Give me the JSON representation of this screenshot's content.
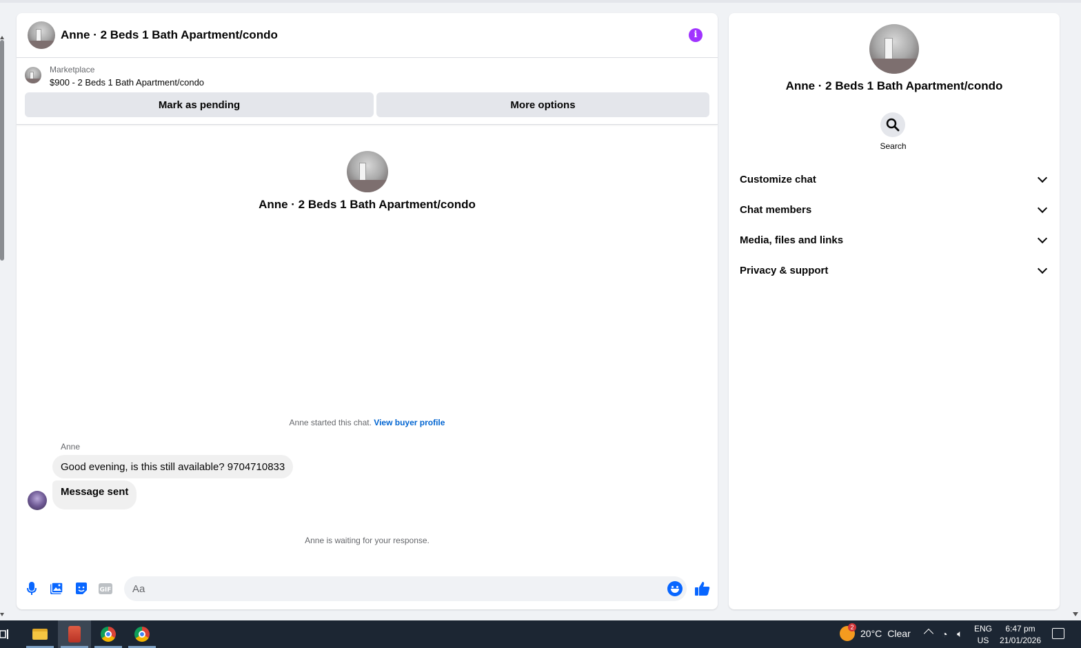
{
  "chat": {
    "title": "Anne · 2 Beds 1 Bath Apartment/condo",
    "info_icon": "info-icon",
    "marketplace": {
      "label": "Marketplace",
      "item": "$900 - 2 Beds 1 Bath Apartment/condo",
      "mark_pending_label": "Mark as pending",
      "more_options_label": "More options"
    },
    "intro_title": "Anne · 2 Beds 1 Bath Apartment/condo",
    "started_text": "Anne started this chat.",
    "view_profile_link": "View buyer profile",
    "messages": [
      {
        "sender": "Anne",
        "text": "Good evening, is this still available? 9704710833"
      },
      {
        "sender": "",
        "text": "Message sent"
      }
    ],
    "waiting_text": "Anne is waiting for your response.",
    "composer": {
      "placeholder": "Aa",
      "icons": [
        "microphone-icon",
        "image-icon",
        "sticker-icon",
        "gif-icon",
        "emoji-icon",
        "like-icon"
      ]
    },
    "accent_color": "#0866ff",
    "info_color": "#a033ff"
  },
  "info_panel": {
    "title": "Anne · 2 Beds 1 Bath Apartment/condo",
    "search_label": "Search",
    "sections": [
      {
        "label": "Customize chat"
      },
      {
        "label": "Chat members"
      },
      {
        "label": "Media, files and links"
      },
      {
        "label": "Privacy & support"
      }
    ]
  },
  "taskbar": {
    "weather": {
      "temp": "20°C",
      "condition": "Clear",
      "badge": "2"
    },
    "language": {
      "line1": "ENG",
      "line2": "US"
    },
    "clock": {
      "time": "6:47 pm",
      "date": "21/01/2026"
    }
  }
}
